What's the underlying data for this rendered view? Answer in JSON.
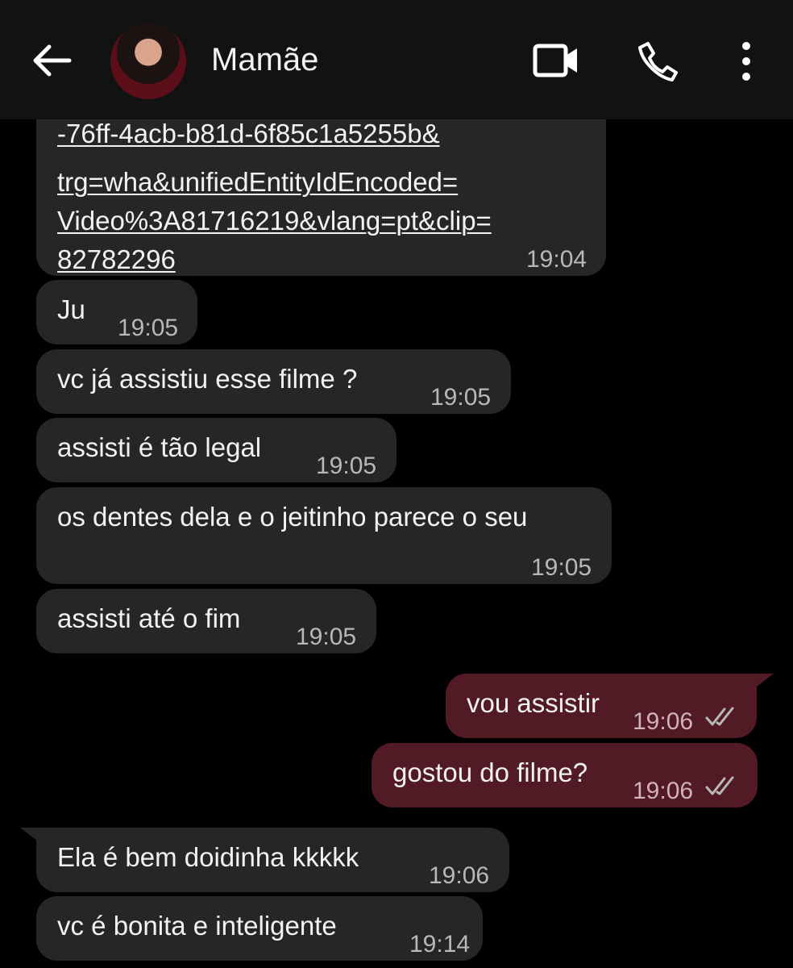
{
  "header": {
    "title": "Mamãe",
    "icons": [
      "back-arrow-icon",
      "video-call-icon",
      "phone-icon",
      "more-vertical-icon"
    ]
  },
  "messages": [
    {
      "from": "contact",
      "type": "link",
      "lines": [
        "-76ff-4acb-b81d-6f85c1a5255b&",
        "trg=wha&unifiedEntityIdEncoded=",
        "Video%3A81716219&vlang=pt&clip=",
        "82782296"
      ],
      "time": "19:04"
    },
    {
      "from": "contact",
      "text": "Ju",
      "time": "19:05"
    },
    {
      "from": "contact",
      "text": "vc já assistiu  esse filme ?",
      "time": "19:05"
    },
    {
      "from": "contact",
      "text": "assisti é tão legal",
      "time": "19:05"
    },
    {
      "from": "contact",
      "text": "os dentes dela e o jeitinho parece o seu",
      "time": "19:05"
    },
    {
      "from": "contact",
      "text": "assisti até o fim",
      "time": "19:05"
    },
    {
      "from": "me",
      "text": "vou assistir",
      "time": "19:06",
      "status": "read"
    },
    {
      "from": "me",
      "text": "gostou do filme?",
      "time": "19:06",
      "status": "read"
    },
    {
      "from": "contact",
      "text": "Ela é bem doidinha kkkkk",
      "time": "19:06"
    },
    {
      "from": "contact",
      "text": "vc é bonita e inteligente",
      "time": "19:14"
    }
  ],
  "colors": {
    "header_bg": "#121212",
    "incoming_bubble": "#262626",
    "outgoing_bubble": "#521a25",
    "background": "#000000"
  }
}
